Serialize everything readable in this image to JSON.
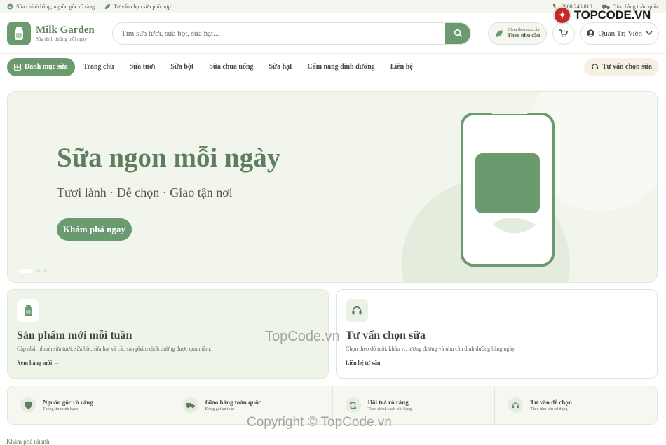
{
  "topbar": {
    "left": [
      {
        "icon": "check-circle-icon",
        "label": "Sữa chính hãng, nguồn gốc rõ ràng"
      },
      {
        "icon": "leaf-icon",
        "label": "Tư vấn chọn sữa phù hợp"
      }
    ],
    "right": [
      {
        "icon": "phone-icon",
        "label": "0908 246 810"
      },
      {
        "icon": "truck-icon",
        "label": "Giao hàng toàn quốc"
      }
    ]
  },
  "brand_watermark": {
    "label": "TOPCODE.VN"
  },
  "header": {
    "logo_name": "Milk Garden",
    "logo_tagline": "Sữa dinh dưỡng mỗi ngày",
    "search_placeholder": "Tìm sữa tươi, sữa bột, sữa hạt...",
    "choose_small": "Chọn theo nhu cầu",
    "choose_main": "Theo nhu cầu",
    "account_label": "Quản Trị Viên"
  },
  "nav": {
    "category_button": "Danh mục sữa",
    "links": [
      "Trang chủ",
      "Sữa tươi",
      "Sữa bột",
      "Sữa chua uống",
      "Sữa hạt",
      "Cẩm nang dinh dưỡng",
      "Liên hệ"
    ],
    "advise_button": "Tư vấn chọn sữa"
  },
  "hero": {
    "title": "Sữa ngon mỗi ngày",
    "subtitle": "Tươi lành · Dễ chọn · Giao tận nơi",
    "cta": "Khám phá ngay",
    "slide_count": 3,
    "active_slide": 1
  },
  "features": [
    {
      "icon": "milk-carton-icon",
      "title": "Sản phẩm mới mỗi tuần",
      "desc": "Cập nhật nhanh sữa tươi, sữa bột, sữa hạt và các sản phẩm dinh dưỡng được quan tâm.",
      "link": "Xem hàng mới →"
    },
    {
      "icon": "headset-icon",
      "title": "Tư vấn chọn sữa",
      "desc": "Chọn theo độ tuổi, khẩu vị, lượng đường và nhu cầu dinh dưỡng hằng ngày.",
      "link": "Liên hệ tư vấn"
    }
  ],
  "perks": [
    {
      "icon": "shield-icon",
      "title": "Nguồn gốc rõ ràng",
      "sub": "Thông tin minh bạch"
    },
    {
      "icon": "truck-icon",
      "title": "Giao hàng toàn quốc",
      "sub": "Đóng gói an toàn"
    },
    {
      "icon": "refresh-icon",
      "title": "Đổi trả rõ ràng",
      "sub": "Theo chính sách cửa hàng"
    },
    {
      "icon": "headset-icon",
      "title": "Tư vấn dễ chọn",
      "sub": "Theo nhu cầu sử dụng"
    }
  ],
  "section_heading": "Khám phá nhanh",
  "watermarks": [
    "TopCode.vn",
    "Copyright © TopCode.vn"
  ],
  "colors": {
    "primary": "#6a9a6e",
    "primary_dark": "#5d7f5f",
    "hero_bg": "#f1f5ec",
    "accent_warm": "#f6f1e3"
  }
}
